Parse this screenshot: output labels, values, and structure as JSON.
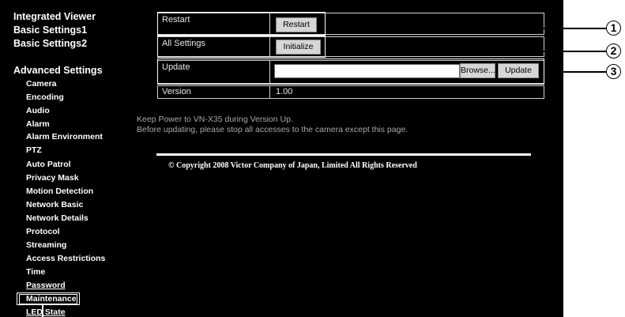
{
  "sidebar": {
    "top_links": [
      "Integrated Viewer",
      "Basic Settings1",
      "Basic Settings2"
    ],
    "section_title": "Advanced Settings",
    "items": [
      "Camera",
      "Encoding",
      "Audio",
      "Alarm",
      "Alarm Environment",
      "PTZ",
      "Auto Patrol",
      "Privacy Mask",
      "Motion Detection",
      "Network Basic",
      "Network Details",
      "Protocol",
      "Streaming",
      "Access Restrictions",
      "Time",
      "Password",
      "Maintenance",
      "LED State"
    ],
    "selected": "Maintenance"
  },
  "table": {
    "restart": {
      "label": "Restart",
      "button": "Restart"
    },
    "all_settings": {
      "label": "All Settings",
      "button": "Initialize"
    },
    "update": {
      "label": "Update",
      "field_value": "",
      "browse_button": "Browse...",
      "update_button": "Update"
    },
    "version": {
      "label": "Version",
      "value": "1.00"
    }
  },
  "notes": [
    "Keep Power to VN-X35 during Version Up.",
    "Before updating, please stop all accesses to the camera except this page."
  ],
  "copyright": "© Copyright 2008 Victor Company of Japan, Limited All Rights Reserved",
  "callouts": [
    "1",
    "2",
    "3"
  ]
}
